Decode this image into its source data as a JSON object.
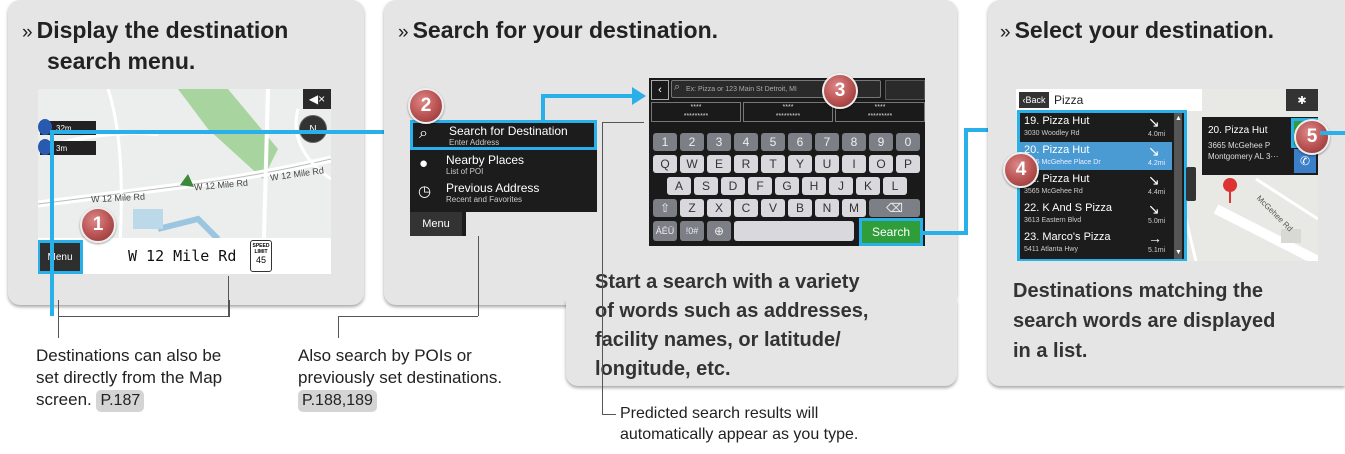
{
  "panel1": {
    "title_line1": "Display the destination",
    "title_line2": "search menu.",
    "screen": {
      "menu_label": "Menu",
      "road_name": "W 12 Mile Rd",
      "speed_sign_line1": "SPEED",
      "speed_sign_line2": "LIMIT",
      "speed_sign_value": "45",
      "compass": "N",
      "dist_1": "32m",
      "dist_2": "3m",
      "map_road_1": "W 12 Mile Rd",
      "map_road_2": "W 12 Mile Rd",
      "map_road_3": "W 12 Mile Rd"
    },
    "badge": "1",
    "note_line1": "Destinations can also be",
    "note_line2": "set directly from the Map",
    "note_line3": "screen.",
    "page_ref": "P.187"
  },
  "panel2": {
    "title": "Search for your destination.",
    "menu": {
      "items": [
        {
          "label": "Search for Destination",
          "sub": "Enter Address"
        },
        {
          "label": "Nearby Places",
          "sub": "List of POI"
        },
        {
          "label": "Previous Address",
          "sub": "Recent and Favorites"
        }
      ],
      "menu_label": "Menu"
    },
    "badge_menu": "2",
    "keyboard": {
      "placeholder": "Ex: Pizza or 123 Main St Detroit, MI",
      "suggestions": [
        "****",
        "****",
        "****"
      ],
      "row_num": [
        "1",
        "2",
        "3",
        "4",
        "5",
        "6",
        "7",
        "8",
        "9",
        "0"
      ],
      "row_q": [
        "Q",
        "W",
        "E",
        "R",
        "T",
        "Y",
        "U",
        "I",
        "O",
        "P"
      ],
      "row_a": [
        "A",
        "S",
        "D",
        "F",
        "G",
        "H",
        "J",
        "K",
        "L"
      ],
      "row_z": [
        "Z",
        "X",
        "C",
        "V",
        "B",
        "N",
        "M"
      ],
      "mode_1": "ÀÉÜ",
      "mode_2": "!0#",
      "search_label": "Search"
    },
    "badge_keyboard": "3",
    "desc_line1": "Start a search with a variety",
    "desc_line2": "of words such as addresses,",
    "desc_line3": "facility names, or latitude/",
    "desc_line4": "longitude, etc.",
    "note_line1": "Also search by POIs or",
    "note_line2": "previously set destinations.",
    "page_ref": "P.188,189",
    "predict_line1": "Predicted search results will",
    "predict_line2": "automatically appear as you type."
  },
  "panel3": {
    "title": "Select your destination.",
    "screen": {
      "back_label": "Back",
      "query": "Pizza",
      "results": [
        {
          "name": "19. Pizza Hut",
          "addr": "3030 Woodley Rd",
          "dist": "4.0mi",
          "arrow": "↘"
        },
        {
          "name": "20. Pizza Hut",
          "addr": "3665 McGehee Place Dr",
          "dist": "4.2mi",
          "arrow": "↘"
        },
        {
          "name": "21. Pizza Hut",
          "addr": "3565 McGehee Rd",
          "dist": "4.4mi",
          "arrow": "↘"
        },
        {
          "name": "22. K And S Pizza",
          "addr": "3613 Eastern Blvd",
          "dist": "5.0mi",
          "arrow": "↘"
        },
        {
          "name": "23. Marco's Pizza",
          "addr": "5411 Atlanta Hwy",
          "dist": "5.1mi",
          "arrow": "→"
        }
      ],
      "popup_name": "20. Pizza Hut",
      "popup_addr1": "3665 McGehee P",
      "popup_addr2": "Montgomery AL 3···",
      "go_label": "GO",
      "map_road": "McGehee Rd"
    },
    "badge_list": "4",
    "badge_go": "5",
    "desc_line1": "Destinations matching the",
    "desc_line2": "search words are displayed",
    "desc_line3": "in a list."
  },
  "colors": {
    "accent": "#2ab0e8",
    "badge": "#b55555",
    "panel": "#e5e5e5",
    "go": "#2f9e3a"
  }
}
